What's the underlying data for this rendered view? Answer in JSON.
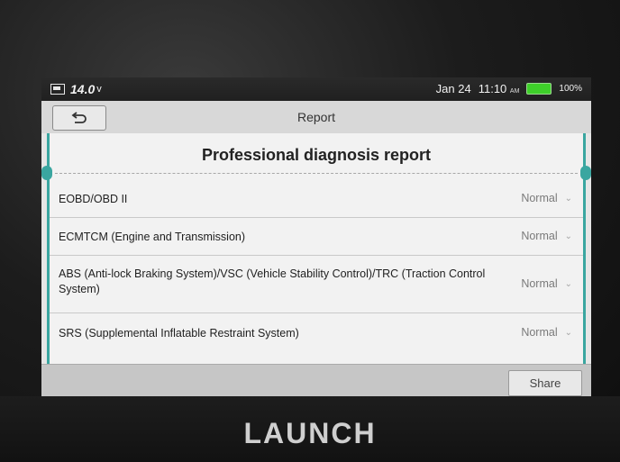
{
  "brand": "LAUNCH",
  "status_bar": {
    "voltage": "14.0",
    "voltage_unit": "v",
    "date": "Jan 24",
    "time": "11:10",
    "ampm": "AM",
    "battery_percent": "100%",
    "battery_level": 1.0,
    "battery_color": "#3ecf2a"
  },
  "title_bar": {
    "title": "Report",
    "back_icon": "back-arrow-icon"
  },
  "report": {
    "heading": "Professional diagnosis report",
    "accent_color": "#3aa6a0",
    "systems": [
      {
        "name": "EOBD/OBD II",
        "status": "Normal"
      },
      {
        "name": "ECMTCM (Engine and Transmission)",
        "status": "Normal"
      },
      {
        "name": "ABS (Anti-lock Braking System)/VSC (Vehicle Stability Control)/TRC (Traction Control System)",
        "status": "Normal"
      },
      {
        "name": "SRS (Supplemental Inflatable Restraint System)",
        "status": "Normal"
      }
    ]
  },
  "footer": {
    "share_label": "Share"
  }
}
